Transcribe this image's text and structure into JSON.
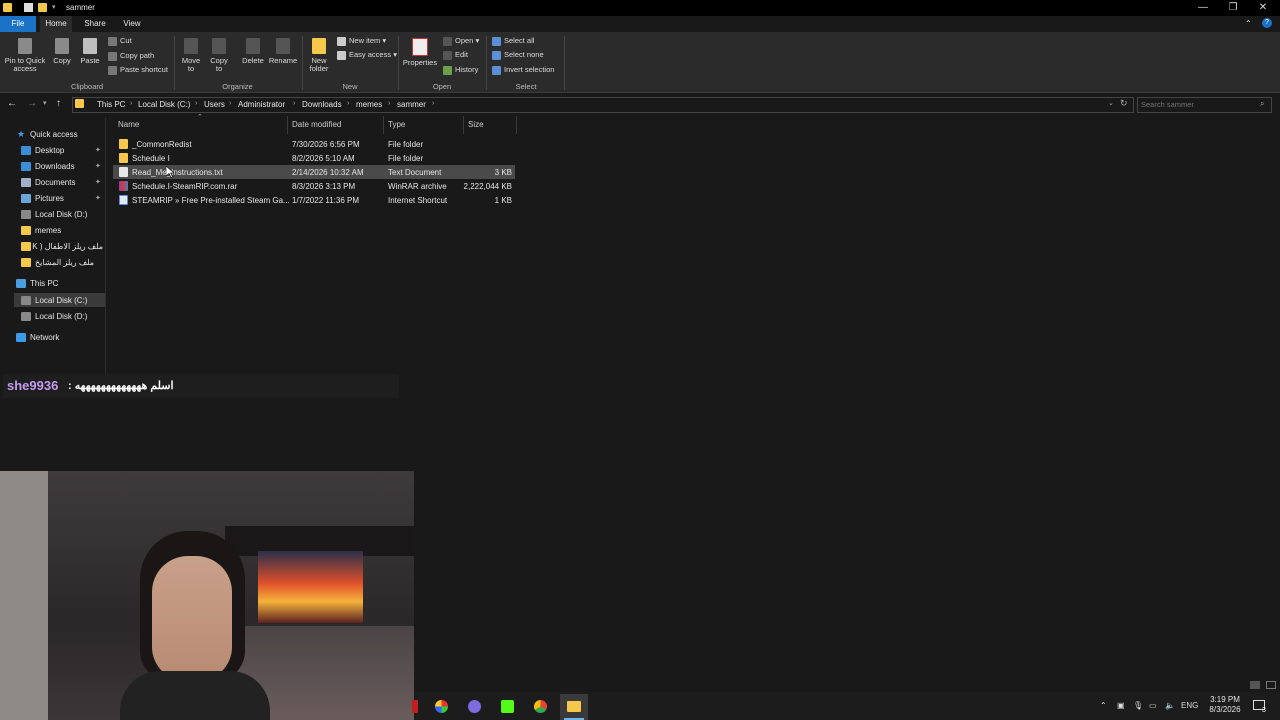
{
  "window": {
    "title": "sammer",
    "minimize": "—",
    "maximize": "❐",
    "close": "✕"
  },
  "tabs": {
    "file": "File",
    "home": "Home",
    "share": "Share",
    "view": "View",
    "help": "?"
  },
  "ribbon": {
    "clipboard": {
      "pin": "Pin to Quick access",
      "copy": "Copy",
      "paste": "Paste",
      "cut": "Cut",
      "copy_path": "Copy path",
      "paste_shortcut": "Paste shortcut",
      "label": "Clipboard"
    },
    "organize": {
      "move_to": "Move to",
      "copy_to": "Copy to",
      "delete": "Delete",
      "rename": "Rename",
      "label": "Organize"
    },
    "new": {
      "new_folder": "New folder",
      "new_item": "New item",
      "easy_access": "Easy access",
      "label": "New"
    },
    "open": {
      "properties": "Properties",
      "open": "Open",
      "edit": "Edit",
      "history": "History",
      "label": "Open"
    },
    "select": {
      "select_all": "Select all",
      "select_none": "Select none",
      "invert": "Invert selection",
      "label": "Select"
    }
  },
  "address": {
    "crumbs": [
      "This PC",
      "Local Disk (C:)",
      "Users",
      "Administrator",
      "Downloads",
      "memes",
      "sammer"
    ],
    "search_placeholder": "Search sammer"
  },
  "nav": {
    "quick_access": "Quick access",
    "desktop": "Desktop",
    "downloads": "Downloads",
    "documents": "Documents",
    "pictures": "Pictures",
    "local_d": "Local Disk (D:)",
    "memes": "memes",
    "arabic1": "ملف ريلز الاطفال ( K",
    "arabic2": "ملف ريلز المشايخ",
    "this_pc": "This PC",
    "local_c": "Local Disk (C:)",
    "local_d2": "Local Disk (D:)",
    "network": "Network"
  },
  "columns": {
    "name": "Name",
    "date": "Date modified",
    "type": "Type",
    "size": "Size"
  },
  "files": [
    {
      "name": "_CommonRedist",
      "date": "7/30/2026 6:56 PM",
      "type": "File folder",
      "size": "",
      "icon": "folder-icon"
    },
    {
      "name": "Schedule I",
      "date": "8/2/2026 5:10 AM",
      "type": "File folder",
      "size": "",
      "icon": "folder-icon"
    },
    {
      "name": "Read_Me_Instructions.txt",
      "date": "2/14/2026 10:32 AM",
      "type": "Text Document",
      "size": "3 KB",
      "icon": "text-file-icon"
    },
    {
      "name": "Schedule.I-SteamRIP.com.rar",
      "date": "8/3/2026 3:13 PM",
      "type": "WinRAR archive",
      "size": "2,222,044 KB",
      "icon": "winrar-icon"
    },
    {
      "name": "STEAMRIP » Free Pre-installed Steam Ga...",
      "date": "1/7/2022 11:36 PM",
      "type": "Internet Shortcut",
      "size": "1 KB",
      "icon": "shortcut-icon"
    }
  ],
  "chat": {
    "user": "she9936",
    "message": ": اسلم هههههههههههههه"
  },
  "taskbar": {
    "lang": "ENG",
    "time": "3:19 PM",
    "date": "8/3/2026",
    "notifications": "3"
  },
  "colors": {
    "accent": "#1a73c7",
    "folder": "#f5c84c",
    "chat_user": "#c79cf0"
  }
}
